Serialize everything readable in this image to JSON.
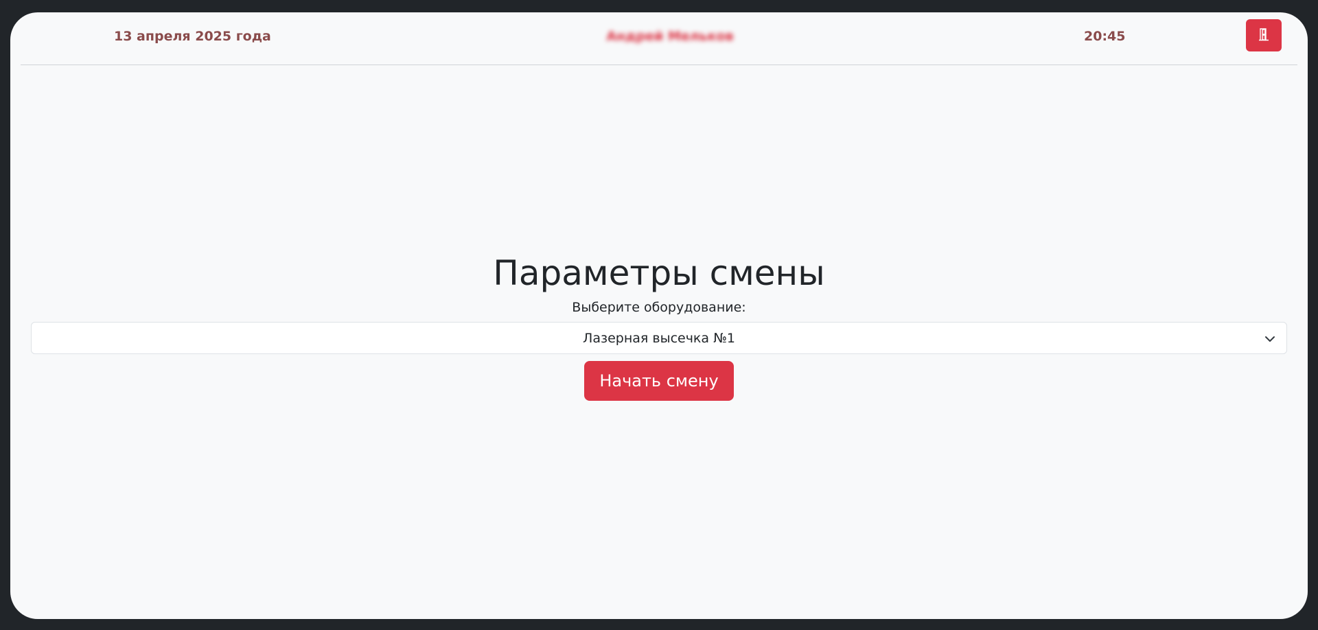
{
  "header": {
    "date": "13 апреля 2025 года",
    "user_name": "Андрей Мельков",
    "time": "20:45",
    "logout_icon": "door-exit-icon"
  },
  "main": {
    "title": "Параметры смены",
    "equipment_label": "Выберите оборудование:",
    "equipment_selected": "Лазерная высечка №1",
    "start_button_label": "Начать смену"
  },
  "colors": {
    "accent": "#dc3545",
    "header_text": "#8a4b4b",
    "background": "#f8f9fa",
    "outer_frame": "#212529"
  }
}
